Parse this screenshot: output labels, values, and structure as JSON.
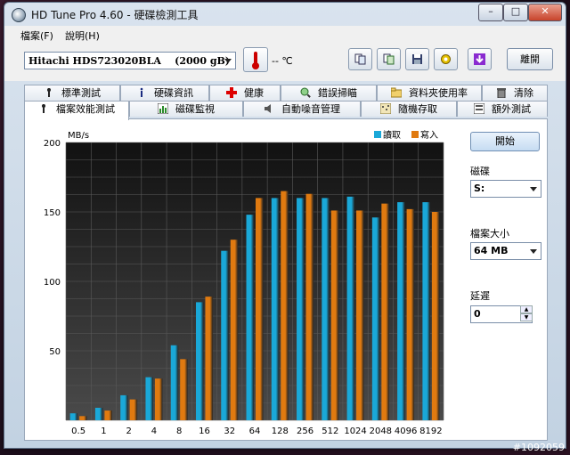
{
  "window": {
    "title": "HD Tune Pro 4.60 - 硬碟檢測工具",
    "controls": {
      "minimize": "–",
      "maximize": "□",
      "close": "✕"
    }
  },
  "menu": {
    "file": "檔案(F)",
    "help": "說明(H)"
  },
  "toolbar": {
    "drive": "Hitachi HDS723020BLA    (2000 gB)",
    "temperature": "-- ℃",
    "exit_label": "離開",
    "buttons": [
      "copy-info-icon",
      "copy-text-icon",
      "save-icon",
      "options-icon",
      "download-icon"
    ]
  },
  "tabs": {
    "row1": [
      "標準測試",
      "硬碟資訊",
      "健康",
      "錯誤掃瞄",
      "資料夾使用率",
      "清除"
    ],
    "row2": [
      "檔案效能測試",
      "磁碟監視",
      "自動噪音管理",
      "隨機存取",
      "額外測試"
    ],
    "active": "檔案效能測試"
  },
  "side": {
    "start_label": "開始",
    "disk_label": "磁碟",
    "disk_value": "S:",
    "size_label": "檔案大小",
    "size_value": "64 MB",
    "delay_label": "延遲",
    "delay_value": "0"
  },
  "chart_data": {
    "type": "bar",
    "ylabel": "MB/s",
    "ylim": [
      0,
      200
    ],
    "yticks": [
      50,
      100,
      150,
      200
    ],
    "categories": [
      "0.5",
      "1",
      "2",
      "4",
      "8",
      "16",
      "32",
      "64",
      "128",
      "256",
      "512",
      "1024",
      "2048",
      "4096",
      "8192"
    ],
    "series": [
      {
        "name": "讀取",
        "color": "#1aa8d8",
        "values": [
          5,
          9,
          18,
          31,
          54,
          85,
          122,
          148,
          160,
          160,
          160,
          161,
          146,
          157,
          157
        ]
      },
      {
        "name": "寫入",
        "color": "#e07a10",
        "values": [
          3,
          7,
          15,
          30,
          44,
          89,
          130,
          160,
          165,
          163,
          151,
          151,
          156,
          152,
          150
        ]
      }
    ],
    "grid": true,
    "legend": "top-right"
  },
  "watermark": "#1092059"
}
